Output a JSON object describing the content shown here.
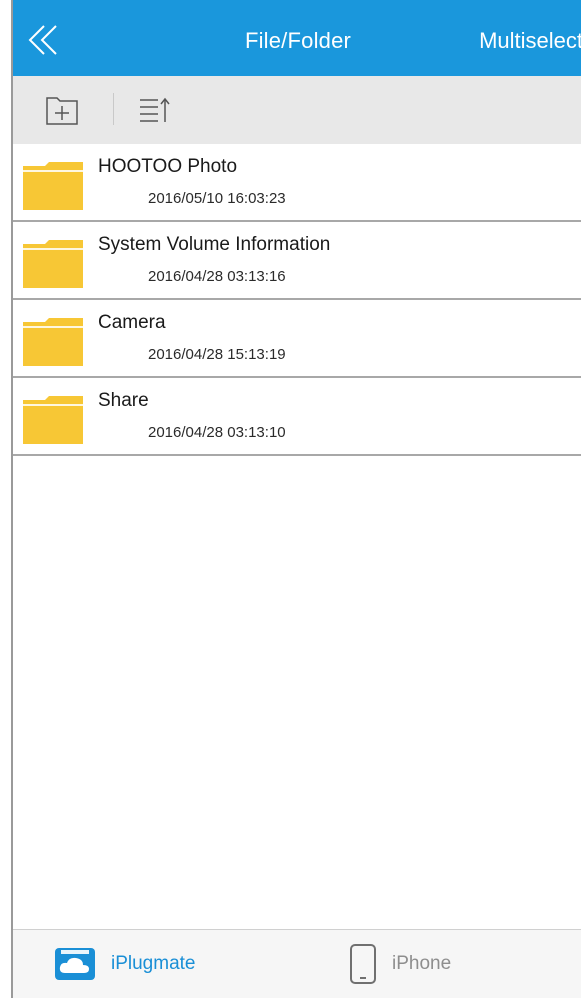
{
  "nav": {
    "title": "File/Folder",
    "multiselect_label": "Multiselect",
    "back_icon": "double-chevron-left-icon"
  },
  "toolbar": {
    "new_folder_icon": "new-folder-icon",
    "sort_icon": "sort-list-icon"
  },
  "files": [
    {
      "name": "HOOTOO Photo",
      "date": "2016/05/10 16:03:23"
    },
    {
      "name": "System Volume Information",
      "date": "2016/04/28 03:13:16"
    },
    {
      "name": "Camera",
      "date": "2016/04/28 15:13:19"
    },
    {
      "name": "Share",
      "date": "2016/04/28 03:13:10"
    }
  ],
  "tabs": [
    {
      "label": "iPlugmate",
      "icon": "cloud-drive-icon",
      "active": true
    },
    {
      "label": "iPhone",
      "icon": "phone-icon",
      "active": false
    }
  ],
  "colors": {
    "accent": "#1a97dc",
    "folder": "#f7c735",
    "toolbar_bg": "#e8e8e8",
    "active_tab": "#1a8fd6",
    "inactive_tab": "#8e8e8e"
  }
}
